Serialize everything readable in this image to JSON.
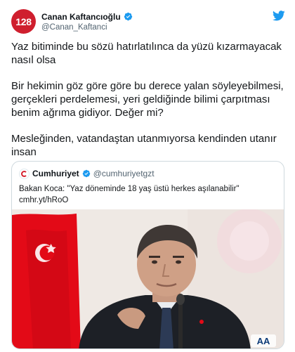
{
  "tweet": {
    "author": {
      "avatar_text": "128",
      "display_name": "Canan Kaftancıoğlu",
      "handle": "@Canan_Kaftanci",
      "verified": true
    },
    "platform_icon": "twitter-bird-icon",
    "paragraphs": [
      "Yaz bitiminde bu sözü hatırlatılınca da yüzü kızarmayacak nasıl olsa",
      "Bir hekimin göz göre göre bu derece yalan söyleyebilmesi, gerçekleri perdelemesi, yeri geldiğinde bilimi çarpıtması benim ağrıma gidiyor. Değer mi?",
      "Mesleğinden, vatandaştan utanmıyorsa kendinden utanır insan"
    ]
  },
  "quoted": {
    "author": {
      "display_name": "Cumhuriyet",
      "handle": "@cumhuriyetgzt",
      "verified": true
    },
    "text": "Bakan Koca: \"Yaz döneminde 18 yaş üstü herkes aşılanabilir\"",
    "link": "cmhr.yt/hRoO",
    "photo": {
      "watermark": "AA"
    }
  },
  "colors": {
    "verified_blue": "#1d9bf0",
    "avatar_red": "#cf1f2e",
    "flag_red": "#e30a17",
    "muted_text": "#536471"
  }
}
